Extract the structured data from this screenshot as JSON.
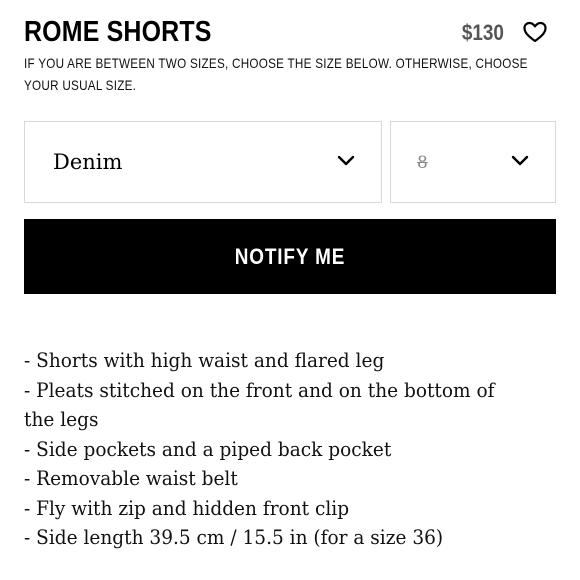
{
  "product": {
    "title": "ROME SHORTS",
    "price": "$130"
  },
  "size_note": "IF YOU ARE BETWEEN TWO SIZES, CHOOSE THE SIZE BELOW. OTHERWISE, CHOOSE YOUR USUAL SIZE.",
  "selectors": {
    "color": {
      "value": "Denim"
    },
    "size": {
      "value": "8"
    }
  },
  "notify_button": {
    "label": "NOTIFY ME"
  },
  "description": [
    "- Shorts with high waist and flared leg",
    "- Pleats stitched on the front and on the bottom of the legs",
    "- Side pockets and a piped back pocket",
    "- Removable waist belt",
    "- Fly with zip and hidden front clip",
    "- Side length 39.5 cm / 15.5 in (for a size 36)"
  ],
  "icons": {
    "favorite": "heart-icon",
    "dropdown": "chevron-down-icon"
  }
}
